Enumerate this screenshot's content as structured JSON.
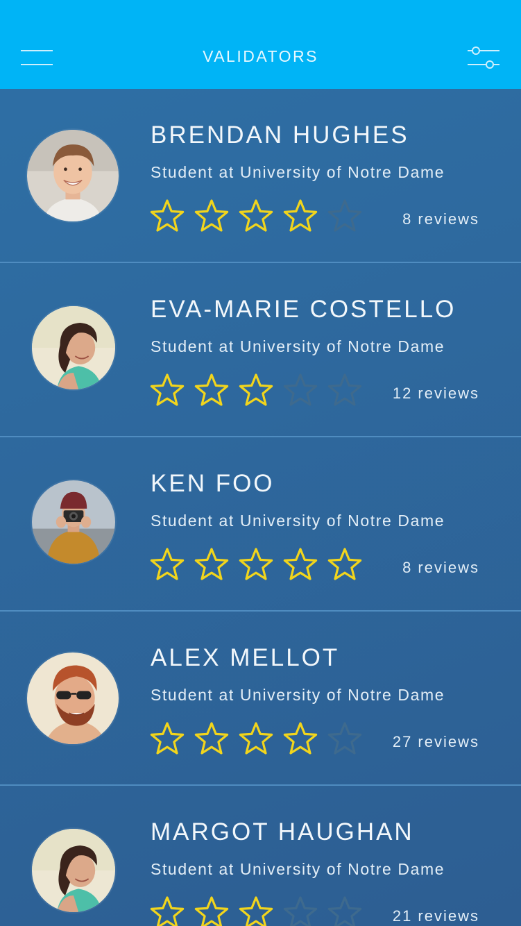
{
  "header": {
    "title": "VALIDATORS",
    "background": "#00b4f6",
    "menu_icon": "hamburger-menu-icon",
    "filter_icon": "sliders-filter-icon"
  },
  "colors": {
    "star_filled": "#f2d51c",
    "star_empty": "#3e6a8e",
    "list_background": "#2e6aa0"
  },
  "validators": [
    {
      "name": "BRENDAN HUGHES",
      "school": "Student at University of Notre Dame",
      "rating": 4,
      "reviews": "8 reviews",
      "avatar_icon": "smiling-young-man-photo"
    },
    {
      "name": "EVA-MARIE COSTELLO",
      "school": "Student at University of Notre Dame",
      "rating": 3,
      "reviews": "12 reviews",
      "avatar_icon": "woman-looking-down-photo"
    },
    {
      "name": "KEN FOO",
      "school": "Student at University of Notre Dame",
      "rating": 5,
      "reviews": "8 reviews",
      "avatar_icon": "man-with-camera-photo"
    },
    {
      "name": "ALEX MELLOT",
      "school": "Student at University of Notre Dame",
      "rating": 4,
      "reviews": "27 reviews",
      "avatar_icon": "man-with-sunglasses-photo"
    },
    {
      "name": "MARGOT HAUGHAN",
      "school": "Student at University of Notre Dame",
      "rating": 3,
      "reviews": "21 reviews",
      "avatar_icon": "woman-looking-down-photo"
    }
  ]
}
